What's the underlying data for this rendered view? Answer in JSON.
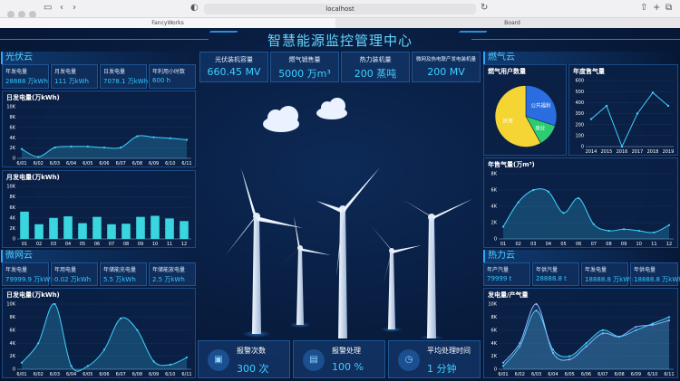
{
  "browser": {
    "url": "localhost",
    "tabs": [
      {
        "label": "FancyWorks",
        "active": true
      },
      {
        "label": "Board",
        "active": false
      }
    ]
  },
  "header": {
    "title": "智慧能源监控管理中心"
  },
  "pv": {
    "title": "光伏云",
    "stats": [
      {
        "label": "年发电量",
        "value": "28888 万kWh"
      },
      {
        "label": "月发电量",
        "value": "111 万kWh"
      },
      {
        "label": "日发电量",
        "value": "7078.1 万kWh"
      },
      {
        "label": "年利用小时数",
        "value": "600 h"
      }
    ]
  },
  "kpis": [
    {
      "label": "光伏装机容量",
      "value": "660.45 MV"
    },
    {
      "label": "燃气销售量",
      "value": "5000 万m³"
    },
    {
      "label": "热力装机量",
      "value": "200 蒸吨"
    },
    {
      "label": "微网及热电联产发电装机量",
      "value": "200 MV"
    }
  ],
  "gas": {
    "title": "燃气云",
    "users_title": "燃气用户数量",
    "annual_title": "年度售气量",
    "yearly_title": "年售气量(万m³)"
  },
  "micro": {
    "title": "微网云",
    "stats": [
      {
        "label": "年发电量",
        "value": "79999.9 万kWh"
      },
      {
        "label": "年用电量",
        "value": "0.02 万kWh"
      },
      {
        "label": "年储能充电量",
        "value": "5.5 万kWh"
      },
      {
        "label": "年储能放电量",
        "value": "2.5 万kWh"
      }
    ]
  },
  "heat": {
    "title": "热力云",
    "stats": [
      {
        "label": "年产汽量",
        "value": "79999 t"
      },
      {
        "label": "年供汽量",
        "value": "28888.8 t"
      },
      {
        "label": "年发电量",
        "value": "18888.8 万kWh"
      },
      {
        "label": "年供电量",
        "value": "18888.8 万kWh"
      }
    ]
  },
  "alarms": [
    {
      "label": "报警次数",
      "value": "300 次",
      "icon": "lock-icon"
    },
    {
      "label": "报警处理",
      "value": "100 %",
      "icon": "monitor-icon"
    },
    {
      "label": "平均处理时间",
      "value": "1 分钟",
      "icon": "clock-icon"
    }
  ],
  "colors": {
    "accent": "#3fd0ff",
    "bar": "#3ad6e0",
    "pie_blue": "#2a6de0",
    "pie_green": "#2ecc71",
    "pie_yellow": "#f5d534"
  },
  "chart_data": [
    {
      "id": "pv_daily",
      "type": "area",
      "title": "日发电量(万kWh)",
      "categories": [
        "6/01",
        "6/02",
        "6/03",
        "6/04",
        "6/05",
        "6/06",
        "6/07",
        "6/08",
        "6/09",
        "6/10",
        "6/11"
      ],
      "values": [
        1800,
        300,
        2100,
        2300,
        2300,
        2100,
        2100,
        4300,
        4100,
        3900,
        3600
      ],
      "ylim": [
        0,
        10000
      ],
      "yticks": [
        "0",
        "2K",
        "4K",
        "6K",
        "8K",
        "10K"
      ]
    },
    {
      "id": "pv_monthly",
      "type": "bar",
      "title": "月发电量(万kWh)",
      "categories": [
        "01",
        "02",
        "03",
        "04",
        "05",
        "06",
        "07",
        "08",
        "09",
        "10",
        "11",
        "12"
      ],
      "values": [
        5200,
        2800,
        4000,
        4300,
        3000,
        4200,
        2800,
        2900,
        4200,
        4400,
        3900,
        3400
      ],
      "ylim": [
        0,
        10000
      ],
      "yticks": [
        "0",
        "2K",
        "4K",
        "6K",
        "8K",
        "10K"
      ]
    },
    {
      "id": "micro_daily",
      "type": "area",
      "title": "日发电量(万kWh)",
      "categories": [
        "6/01",
        "6/02",
        "6/03",
        "6/04",
        "6/05",
        "6/06",
        "6/07",
        "6/08",
        "6/09",
        "6/10",
        "6/11"
      ],
      "values": [
        1000,
        4000,
        10000,
        500,
        500,
        3000,
        7800,
        6000,
        1200,
        700,
        1800
      ],
      "ylim": [
        0,
        10000
      ],
      "yticks": [
        "0",
        "2K",
        "4K",
        "6K",
        "8K",
        "10K"
      ]
    },
    {
      "id": "gas_users",
      "type": "pie",
      "title": "燃气用户数量",
      "slices": [
        {
          "name": "公共福利",
          "value": 30,
          "color": "#2a6de0"
        },
        {
          "name": "商业",
          "value": 12,
          "color": "#2ecc71"
        },
        {
          "name": "民用",
          "value": 58,
          "color": "#f5d534"
        }
      ]
    },
    {
      "id": "gas_annual",
      "type": "line",
      "title": "年度售气量",
      "categories": [
        "2014",
        "2015",
        "2016",
        "2017",
        "2018",
        "2019"
      ],
      "values": [
        250,
        370,
        0,
        300,
        490,
        370
      ],
      "ylim": [
        0,
        600
      ],
      "yticks": [
        "0",
        "100",
        "200",
        "300",
        "400",
        "500",
        "600"
      ]
    },
    {
      "id": "gas_yearly",
      "type": "area",
      "title": "年售气量(万m³)",
      "categories": [
        "01",
        "02",
        "03",
        "04",
        "05",
        "06",
        "07",
        "08",
        "09",
        "10",
        "11",
        "12"
      ],
      "values": [
        1500,
        4500,
        6000,
        5800,
        3200,
        5000,
        1800,
        1000,
        1200,
        1000,
        800,
        1700
      ],
      "ylim": [
        0,
        8000
      ],
      "yticks": [
        "0",
        "2K",
        "4K",
        "6K",
        "8K"
      ]
    },
    {
      "id": "heat_daily",
      "type": "area",
      "title": "发电量/产气量",
      "categories": [
        "6/01",
        "6/02",
        "6/03",
        "6/04",
        "6/05",
        "6/06",
        "6/07",
        "6/08",
        "6/09",
        "6/10",
        "6/11"
      ],
      "series": [
        {
          "name": "发电量",
          "values": [
            500,
            3500,
            9000,
            3000,
            2000,
            4000,
            6000,
            5000,
            6000,
            7000,
            8000
          ]
        },
        {
          "name": "产气量",
          "values": [
            1000,
            4000,
            10000,
            2500,
            1500,
            3500,
            5500,
            5000,
            6500,
            6800,
            7500
          ]
        }
      ],
      "ylim": [
        0,
        10000
      ],
      "yticks": [
        "0",
        "2K",
        "4K",
        "6K",
        "8K",
        "10K"
      ]
    }
  ]
}
